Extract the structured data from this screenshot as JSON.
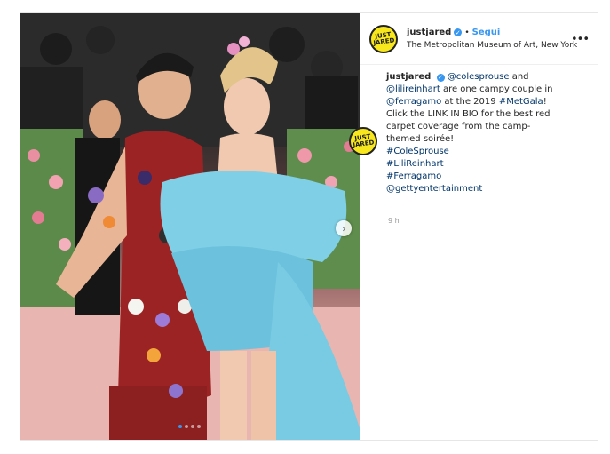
{
  "post": {
    "username": "justjared",
    "follow_label": "Segui",
    "separator": "•",
    "location": "The Metropolitan Museum of Art, New York",
    "more_icon": "more-options-icon",
    "avatar_logo_line1": "JUST",
    "avatar_logo_line2": "JARED",
    "colors": {
      "avatar_bg": "#f8e71c",
      "link": "#003569",
      "follow": "#3897f0"
    }
  },
  "caption": {
    "username": "justjared",
    "lines": [
      [
        "@colesprouse",
        " and"
      ],
      [
        "@lilireinhart",
        " are one campy couple in"
      ],
      [
        "@ferragamo",
        " at the 2019 ",
        "#MetGala",
        "!"
      ],
      [
        "Click the LINK IN BIO for the best red"
      ],
      [
        "carpet coverage from the camp-"
      ],
      [
        "themed soirée!"
      ],
      [
        "#ColeSprouse"
      ],
      [
        "#LiliReinhart"
      ],
      [
        "#Ferragamo"
      ],
      [
        "@gettyentertainment"
      ]
    ],
    "meta": "9 h"
  },
  "carousel": {
    "slide_count": 4,
    "active_index": 0,
    "next_icon": "chevron-right-icon"
  }
}
